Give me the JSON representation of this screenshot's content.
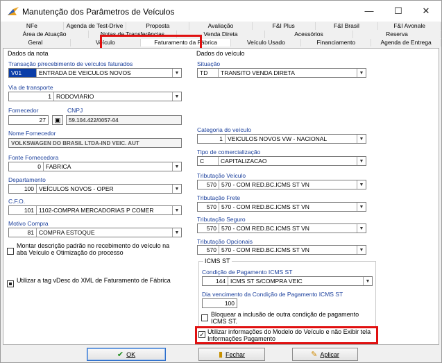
{
  "window": {
    "title": "Manutenção dos Parâmetros de Veículos",
    "minimize": "—",
    "maximize": "☐",
    "close": "✕"
  },
  "tabs": {
    "row1": [
      "NFe",
      "Agenda de Test-Drive",
      "Proposta",
      "Avaliação",
      "F&I Plus",
      "F&I Brasil",
      "F&I Avonale"
    ],
    "row2": [
      "Área de Atuação",
      "Notas de Transferências",
      "Venda Direta",
      "Acessórios",
      "Reserva"
    ],
    "row3": [
      "Geral",
      "Veículo",
      "Faturamento da Fábrica",
      "Veículo Usado",
      "Financiamento",
      "Agenda de Entrega"
    ],
    "active": "Faturamento da Fábrica"
  },
  "left": {
    "group_title": "Dados da nota",
    "transacao": {
      "label": "Transação p/recebimento de veículos faturados",
      "code": "V01",
      "desc": "ENTRADA DE VEICULOS NOVOS"
    },
    "via": {
      "label": "Via de transporte",
      "code": "1",
      "desc": "RODOVIARIO"
    },
    "fornecedor": {
      "label": "Fornecedor",
      "code": "27",
      "cnpj_label": "CNPJ",
      "cnpj": "59.104.422/0057-04"
    },
    "nome_fornecedor": {
      "label": "Nome Fornecedor",
      "value": "VOLKSWAGEN DO BRASIL LTDA-IND VEIC. AUT"
    },
    "fonte": {
      "label": "Fonte Fornecedora",
      "code": "0",
      "desc": "FABRICA"
    },
    "departamento": {
      "label": "Departamento",
      "code": "100",
      "desc": "VEÍCULOS NOVOS - OPER"
    },
    "cfo": {
      "label": "C.F.O.",
      "code": "101",
      "desc": "1102-COMPRA MERCADORIAS P COMER"
    },
    "motivo": {
      "label": "Motivo Compra",
      "code": "81",
      "desc": "COMPRA ESTOQUE"
    },
    "chk_montar": "Montar descrição padrão no recebimento do veículo na aba Veículo e Otimização do processo",
    "chk_vdesc": "Utilizar a tag vDesc do XML de Faturamento de Fábrica"
  },
  "right": {
    "group_title": "Dados do veículo",
    "situacao": {
      "label": "Situação",
      "code": "TD",
      "desc": "TRANSITO VENDA DIRETA"
    },
    "categoria": {
      "label": "Categoria do veículo",
      "code": "1",
      "desc": "VEICULOS NOVOS VW - NACIONAL"
    },
    "tipo": {
      "label": "Tipo de comercialização",
      "code": "C",
      "desc": "CAPITALIZACAO"
    },
    "trib_veiculo": {
      "label": "Tributação Veículo",
      "code": "570",
      "desc": "570 - COM RED.BC.ICMS ST VN"
    },
    "trib_frete": {
      "label": "Tributação Frete",
      "code": "570",
      "desc": "570 - COM RED.BC.ICMS ST VN"
    },
    "trib_seguro": {
      "label": "Tributação Seguro",
      "code": "570",
      "desc": "570 - COM RED.BC.ICMS ST VN"
    },
    "trib_opcionais": {
      "label": "Tributação Opcionais",
      "code": "570",
      "desc": "570 - COM RED.BC.ICMS ST VN"
    },
    "icms": {
      "title": "ICMS ST",
      "cond_label": "Condição de Pagamento ICMS ST",
      "cond_code": "144",
      "cond_desc": "ICMS ST S/COMPRA VEIC",
      "venc_label": "Dia vencimento da Condição de Pagamento ICMS ST",
      "venc_value": "100",
      "chk_bloquear": "Bloquear a inclusão de outra condição de pagamento ICMS ST."
    },
    "chk_utilizar": "Utilizar informações do Modelo do Veículo e não Exibir tela Informações Pagamento"
  },
  "buttons": {
    "ok": "OK",
    "fechar": "Fechar",
    "aplicar": "Aplicar"
  },
  "colors": {
    "label_blue": "#1a3f9c",
    "highlight_red": "#e01010",
    "selection_blue": "#0a3da8"
  }
}
